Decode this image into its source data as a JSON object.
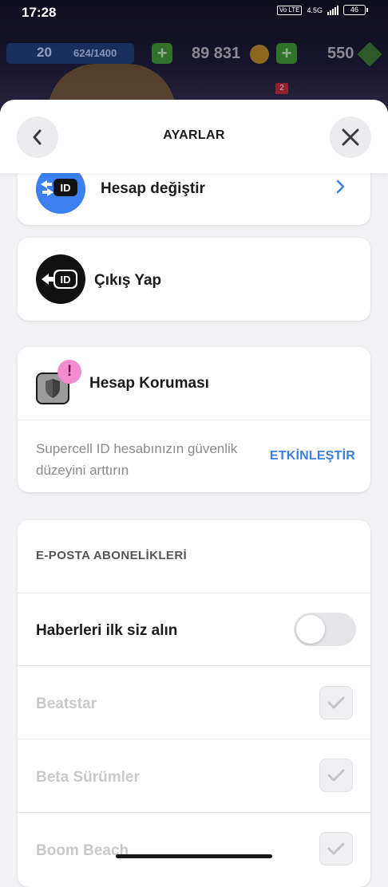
{
  "status_bar": {
    "time": "17:28",
    "network_tag": "Vo LTE",
    "network_type": "4.5G",
    "battery": "46"
  },
  "game_hud": {
    "level": "20",
    "xp": "624/1400",
    "coins": "89 831",
    "gems": "550",
    "notification_count": "2"
  },
  "header": {
    "title": "AYARLAR",
    "back_icon": "chevron-left-icon",
    "close_icon": "close-icon"
  },
  "account": {
    "switch_label": "Hesap değiştir",
    "switch_icon_text": "ID",
    "logout_label": "Çıkış Yap",
    "logout_icon_text": "ID"
  },
  "protection": {
    "title": "Hesap Koruması",
    "alert": "!",
    "description": "Supercell ID hesabınızın güvenlik düzeyini arttırın",
    "action": "ETKİNLEŞTİR"
  },
  "email": {
    "section_title": "E-POSTA ABONELİKLERİ",
    "news_label": "Haberleri ilk siz alın",
    "news_enabled": false,
    "items": [
      {
        "label": "Beatstar",
        "checked": true,
        "disabled": true
      },
      {
        "label": "Beta Sürümler",
        "checked": true,
        "disabled": true
      },
      {
        "label": "Boom Beach",
        "checked": true,
        "disabled": true
      }
    ]
  },
  "colors": {
    "accent": "#3b7fde",
    "switch_icon_bg": "#3b7ff0",
    "logout_icon_bg": "#111111",
    "alert_bg": "#f28bd0"
  }
}
